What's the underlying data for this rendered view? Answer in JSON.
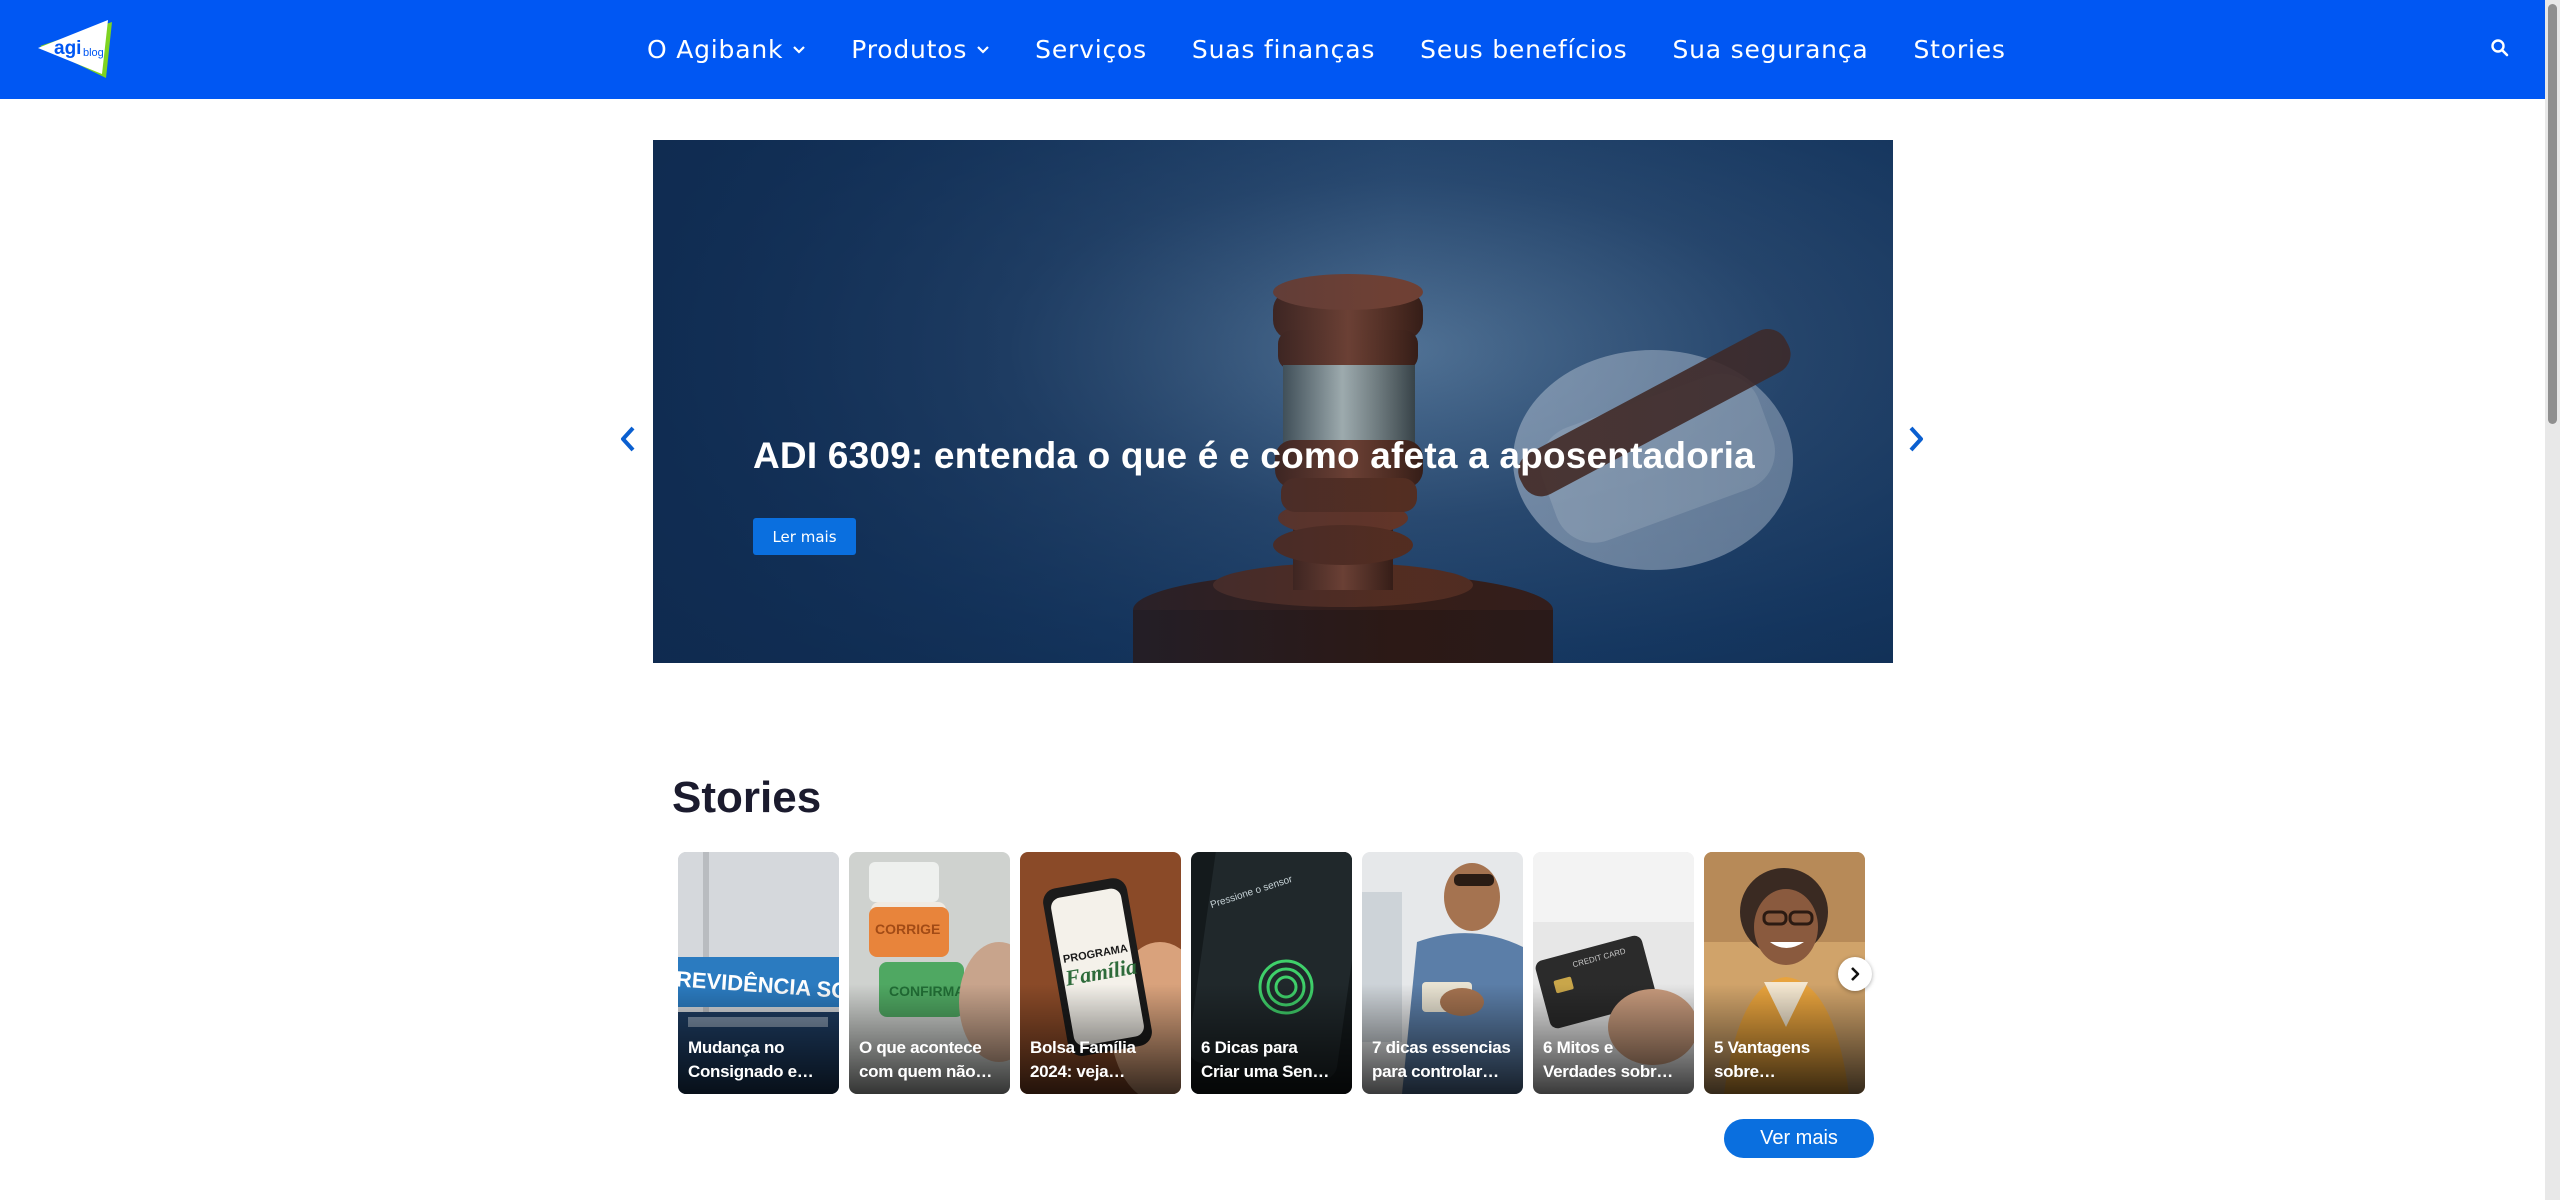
{
  "header": {
    "logo_text": "agiblog",
    "nav": [
      {
        "label": "O Agibank",
        "has_dropdown": true
      },
      {
        "label": "Produtos",
        "has_dropdown": true
      },
      {
        "label": "Serviços",
        "has_dropdown": false
      },
      {
        "label": "Suas finanças",
        "has_dropdown": false
      },
      {
        "label": "Seus benefícios",
        "has_dropdown": false
      },
      {
        "label": "Sua segurança",
        "has_dropdown": false
      },
      {
        "label": "Stories",
        "has_dropdown": false
      }
    ],
    "search_icon": "search-icon"
  },
  "hero": {
    "title": "ADI 6309: entenda o que é e como afeta a aposentadoria",
    "button_label": "Ler mais",
    "prev_icon": "chevron-left-icon",
    "next_icon": "chevron-right-icon"
  },
  "stories": {
    "title": "Stories",
    "items": [
      {
        "line1": "Mudança no",
        "line2": "Consignado e…"
      },
      {
        "line1": "O que acontece",
        "line2": "com quem não…"
      },
      {
        "line1": "Bolsa Família",
        "line2": "2024: veja…"
      },
      {
        "line1": "6 Dicas para",
        "line2": "Criar uma Sen…"
      },
      {
        "line1": "7 dicas essencias",
        "line2": "para controlar…"
      },
      {
        "line1": "6 Mitos e",
        "line2": "Verdades sobr…"
      },
      {
        "line1": "5 Vantagens",
        "line2": "sobre…"
      }
    ],
    "more_label": "Ver mais",
    "next_icon": "chevron-right-icon"
  },
  "colors": {
    "header_bg": "#0057f3",
    "accent": "#0a6fdf",
    "text_dark": "#1b1b2e"
  }
}
